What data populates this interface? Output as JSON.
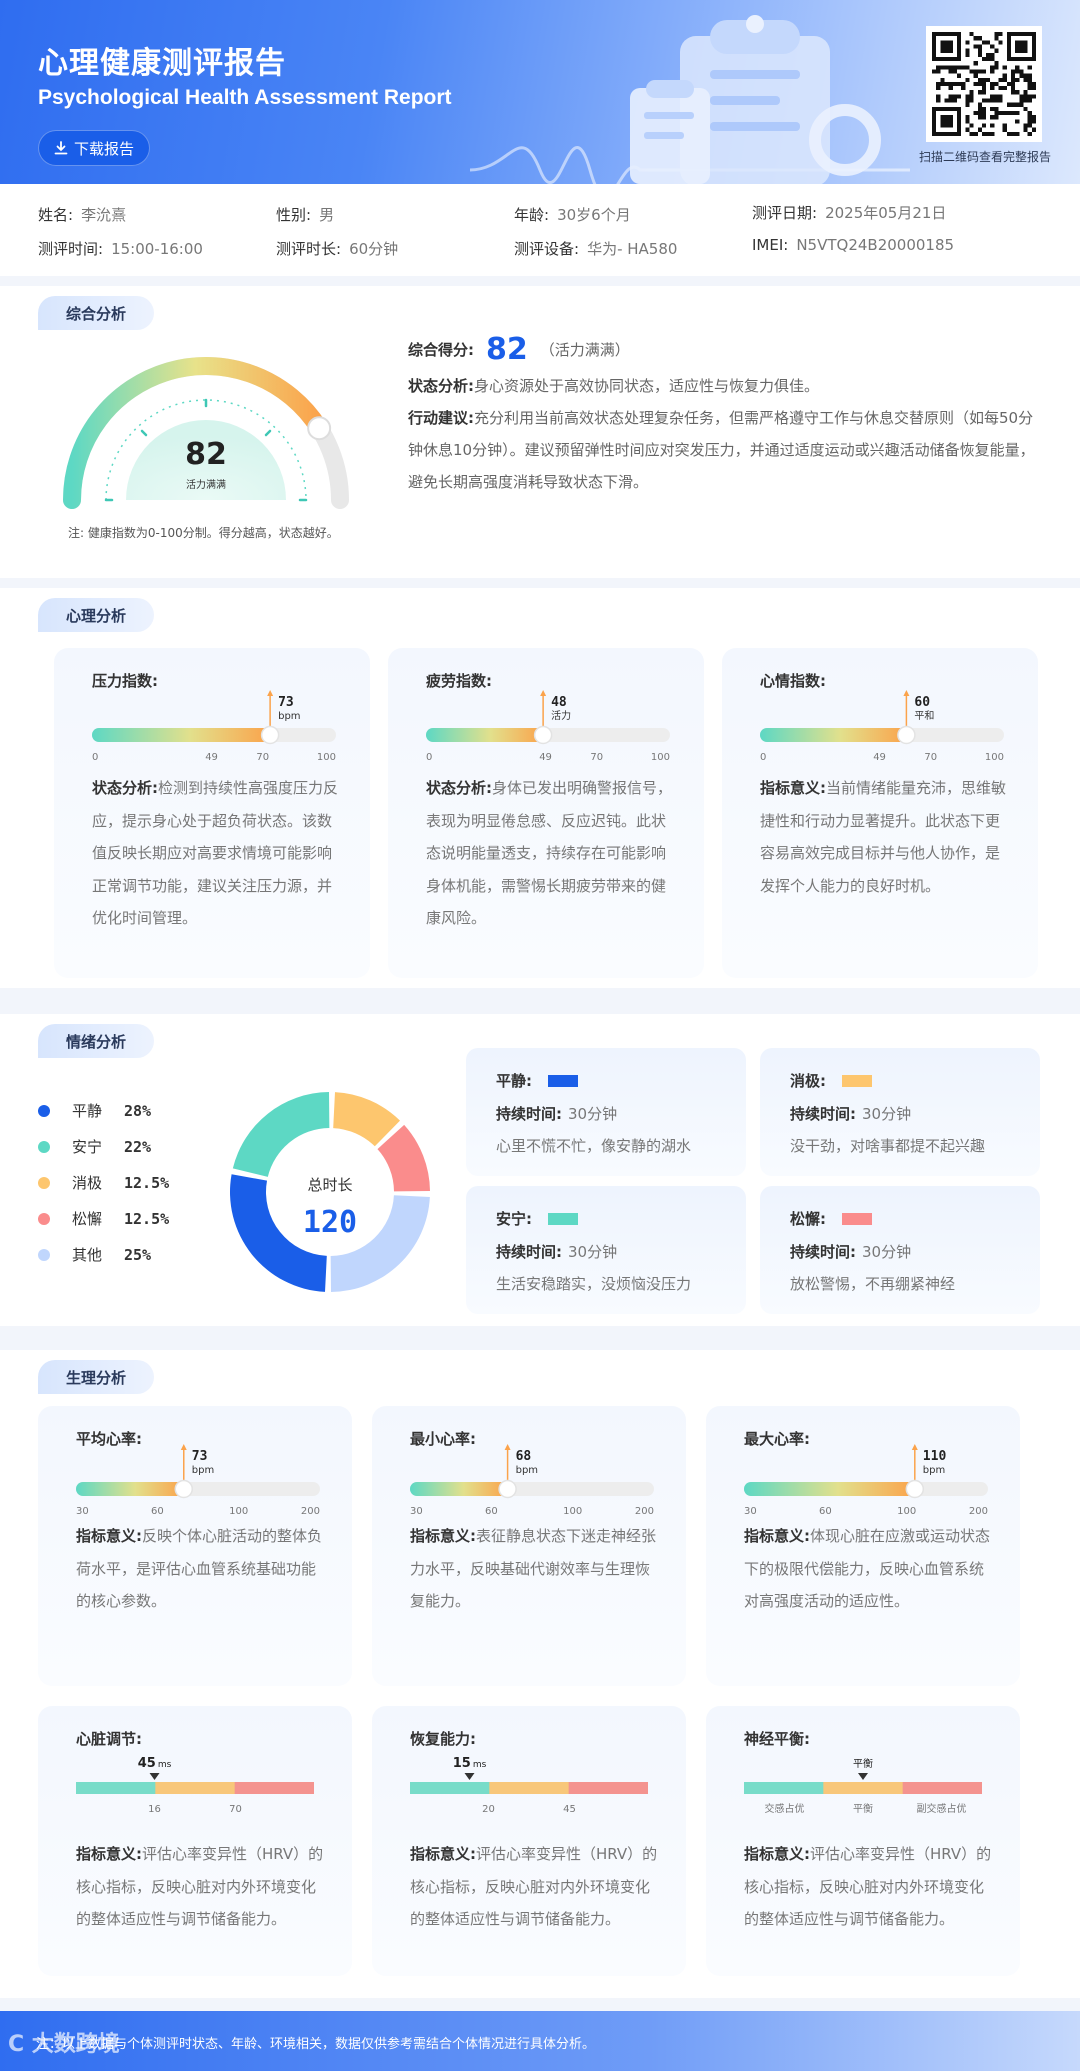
{
  "header": {
    "title": "心理健康测评报告",
    "subtitle": "Psychological Health Assessment Report",
    "download_label": "下载报告",
    "qr_tip": "扫描二维码查看完整报告"
  },
  "info": {
    "name_k": "姓名:",
    "name_v": "李沇熹",
    "gender_k": "性别:",
    "gender_v": "男",
    "age_k": "年龄:",
    "age_v": "30岁6个月",
    "date_k": "测评日期:",
    "date_v": "2025年05月21日",
    "time_k": "测评时间:",
    "time_v": "15:00-16:00",
    "duration_k": "测评时长:",
    "duration_v": "60分钟",
    "device_k": "测评设备:",
    "device_v": "华为- HA580",
    "imei_k": "IMEI:",
    "imei_v": "N5VTQ24B20000185"
  },
  "overall": {
    "tab": "综合分析",
    "score": "82",
    "score_value": 82,
    "score_label": "活力满满",
    "note": "注: 健康指数为0-100分制。得分越高，状态越好。",
    "score_k": "综合得分:",
    "score_tag": "（活力满满）",
    "state_k": "状态分析:",
    "state_v": "身心资源处于高效协同状态，适应性与恢复力俱佳。",
    "action_k": "行动建议:",
    "action_v": "充分利用当前高效状态处理复杂任务，但需严格遵守工作与休息交替原则（如每50分钟休息10分钟）。建议预留弹性时间应对突发压力，并通过适度运动或兴趣活动储备恢复能量，避免长期高强度消耗导致状态下滑。"
  },
  "psych": {
    "tab": "心理分析",
    "cards": [
      {
        "title": "压力指数:",
        "value": "73",
        "unit": "bpm",
        "value_num": 73,
        "ticks": [
          "0",
          "49",
          "70",
          "100"
        ],
        "k": "状态分析:",
        "desc": "检测到持续性高强度压力反应，提示身心处于超负荷状态。该数值反映长期应对高要求情境可能影响正常调节功能，建议关注压力源，并优化时间管理。"
      },
      {
        "title": "疲劳指数:",
        "value": "48",
        "unit": "活力",
        "value_num": 48,
        "ticks": [
          "0",
          "49",
          "70",
          "100"
        ],
        "k": "状态分析:",
        "desc": "身体已发出明确警报信号，表现为明显倦怠感、反应迟钝。此状态说明能量透支，持续存在可能影响身体机能，需警惕长期疲劳带来的健康风险。"
      },
      {
        "title": "心情指数:",
        "value": "60",
        "unit": "平和",
        "value_num": 60,
        "ticks": [
          "0",
          "49",
          "70",
          "100"
        ],
        "k": "指标意义:",
        "desc": "当前情绪能量充沛，思维敏捷性和行动力显著提升。此状态下更容易高效完成目标并与他人协作，是发挥个人能力的良好时机。"
      }
    ]
  },
  "emotion": {
    "tab": "情绪分析",
    "total_label": "总时长",
    "total_value": "120",
    "legend": [
      {
        "name": "平静",
        "pct": "28%",
        "color": "#1a5ee8",
        "value": 28
      },
      {
        "name": "安宁",
        "pct": "22%",
        "color": "#5dd8c4",
        "value": 22
      },
      {
        "name": "消极",
        "pct": "12.5%",
        "color": "#fdc66e",
        "value": 12.5
      },
      {
        "name": "松懈",
        "pct": "12.5%",
        "color": "#fa8c8c",
        "value": 12.5
      },
      {
        "name": "其他",
        "pct": "25%",
        "color": "#c0d6fd",
        "value": 25
      }
    ],
    "cards": [
      {
        "title": "平静:",
        "color": "#1a5ee8",
        "dur_k": "持续时间:",
        "dur_v": "30分钟",
        "desc": "心里不慌不忙，像安静的湖水"
      },
      {
        "title": "消极:",
        "color": "#fdc66e",
        "dur_k": "持续时间:",
        "dur_v": "30分钟",
        "desc": "没干劲，对啥事都提不起兴趣"
      },
      {
        "title": "安宁:",
        "color": "#5dd8c4",
        "dur_k": "持续时间:",
        "dur_v": "30分钟",
        "desc": "生活安稳踏实，没烦恼没压力"
      },
      {
        "title": "松懈:",
        "color": "#fa8c8c",
        "dur_k": "持续时间:",
        "dur_v": "30分钟",
        "desc": "放松警惕，不再绷紧神经"
      }
    ]
  },
  "physio": {
    "tab": "生理分析",
    "hr_cards": [
      {
        "title": "平均心率:",
        "value": "73",
        "unit": "bpm",
        "value_num": 73,
        "ticks": [
          "30",
          "60",
          "100",
          "200"
        ],
        "k": "指标意义:",
        "desc": "反映个体心脏活动的整体负荷水平，是评估心血管系统基础功能的核心参数。"
      },
      {
        "title": "最小心率:",
        "value": "68",
        "unit": "bpm",
        "value_num": 68,
        "ticks": [
          "30",
          "60",
          "100",
          "200"
        ],
        "k": "指标意义:",
        "desc": "表征静息状态下迷走神经张力水平，反映基础代谢效率与生理恢复能力。"
      },
      {
        "title": "最大心率:",
        "value": "110",
        "unit": "bpm",
        "value_num": 110,
        "ticks": [
          "30",
          "60",
          "100",
          "200"
        ],
        "k": "指标意义:",
        "desc": "体现心脏在应激或运动状态下的极限代偿能力，反映心血管系统对高强度活动的适应性。"
      }
    ],
    "hrv_cards": [
      {
        "title": "心脏调节:",
        "value": "45",
        "unit": "ms",
        "ticks": [
          "16",
          "70"
        ],
        "k": "指标意义:",
        "desc": "评估心率变异性（HRV）的核心指标，反映心脏对内外环境变化的整体适应性与调节储备能力。"
      },
      {
        "title": "恢复能力:",
        "value": "15",
        "unit": "ms",
        "ticks": [
          "20",
          "45"
        ],
        "k": "指标意义:",
        "desc": "评估心率变异性（HRV）的核心指标，反映心脏对内外环境变化的整体适应性与调节储备能力。"
      },
      {
        "title": "神经平衡:",
        "value": "平衡",
        "unit": "",
        "ticks": [
          "交感占优",
          "平衡",
          "副交感占优"
        ],
        "k": "指标意义:",
        "desc": "评估心率变异性（HRV）的核心指标，反映心脏对内外环境变化的整体适应性与调节储备能力。"
      }
    ]
  },
  "footer": {
    "text": "注：以上数据与个体测评时状态、年龄、环境相关，数据仅供参考需结合个体情况进行具体分析。",
    "watermark": "C 大数跨境"
  }
}
